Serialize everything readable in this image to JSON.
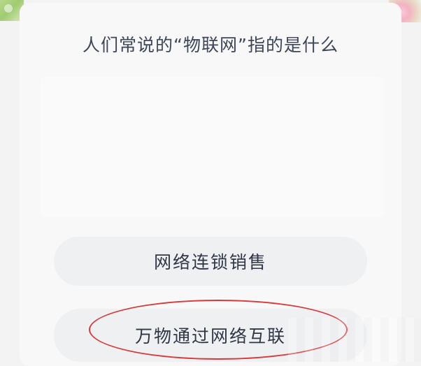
{
  "question": {
    "text": "人们常说的“物联网”指的是什么"
  },
  "options": [
    {
      "label": "网络连锁销售"
    },
    {
      "label": "万物通过网络互联"
    }
  ],
  "annotation": {
    "circle_color": "#d63a3a"
  },
  "colors": {
    "card_bg": "#f8f8f8",
    "option_bg": "#eff0f2",
    "question_text": "#3d4658"
  }
}
